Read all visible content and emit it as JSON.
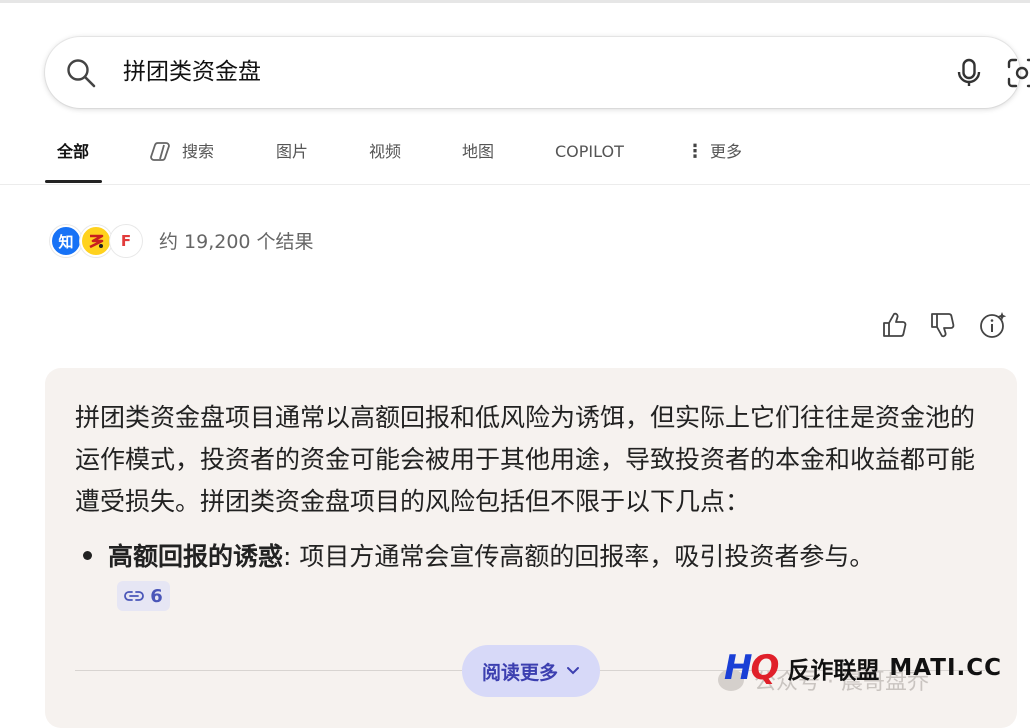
{
  "search": {
    "query": "拼团类资金盘"
  },
  "tabs": [
    {
      "label": "全部"
    },
    {
      "label": "搜索"
    },
    {
      "label": "图片"
    },
    {
      "label": "视频"
    },
    {
      "label": "地图"
    },
    {
      "label": "COPILOT"
    },
    {
      "label": "更多"
    }
  ],
  "results": {
    "source_icons": [
      {
        "glyph": "知",
        "bg": "#1772f6",
        "fg": "#ffffff"
      },
      {
        "glyph": "",
        "bg": "#ffd21e",
        "fg": "#c81f1f"
      },
      {
        "glyph": "F",
        "bg": "#ffffff",
        "fg": "#e23b3b"
      }
    ],
    "count_text": "约 19,200 个结果"
  },
  "answer": {
    "paragraph": "拼团类资金盘项目通常以高额回报和低风险为诱饵，但实际上它们往往是资金池的运作模式，投资者的资金可能会被用于其他用途，导致投资者的本金和收益都可能遭受损失。拼团类资金盘项目的风险包括但不限于以下几点：",
    "bullets": [
      {
        "title": "高额回报的诱惑",
        "text": ": 项目方通常会宣传高额的回报率，吸引投资者参与。",
        "citation": "6"
      }
    ],
    "read_more": "阅读更多"
  },
  "watermark": {
    "faded_text": "公众号 · 晨哥盘乔",
    "logo": "HQ",
    "brand": "反诈联盟",
    "site": "MATI.CC"
  },
  "colors": {
    "card_bg": "#f6f2ef",
    "accent": "#3c3fb0",
    "readmore_bg": "#d7d9f8"
  }
}
